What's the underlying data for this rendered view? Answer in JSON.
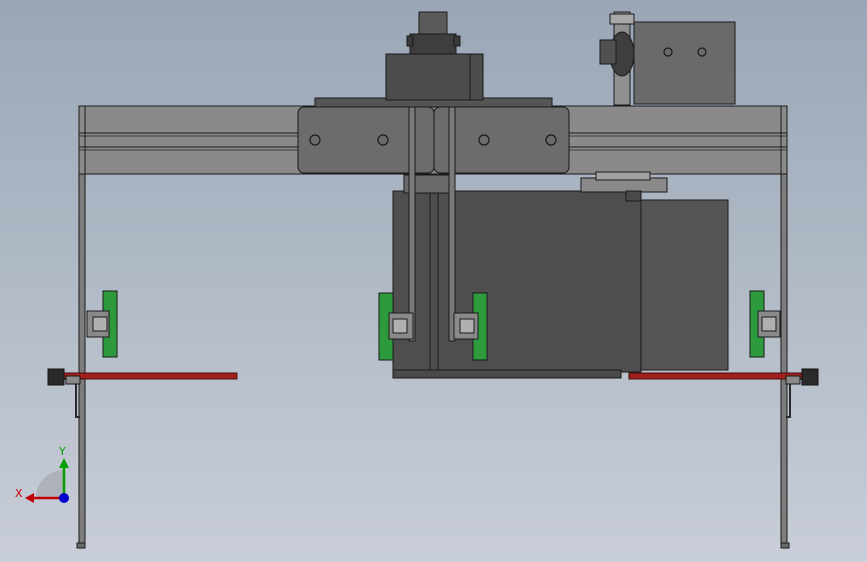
{
  "viewport": {
    "background_top": "#9aa6b6",
    "background_bottom": "#c9ced8"
  },
  "colors": {
    "outline": "#1a1a1a",
    "frame_gray": "#7a7a7a",
    "plate_gray": "#6e6e6e",
    "motor_dark": "#4a4a4a",
    "motor_side": "#555555",
    "guide_green": "#2e9a3e",
    "rod_red": "#a02020",
    "axis_x": "#c00000",
    "axis_y": "#00a000",
    "axis_z": "#0000cc"
  },
  "triad": {
    "x_label": "X",
    "y_label": "Y"
  }
}
